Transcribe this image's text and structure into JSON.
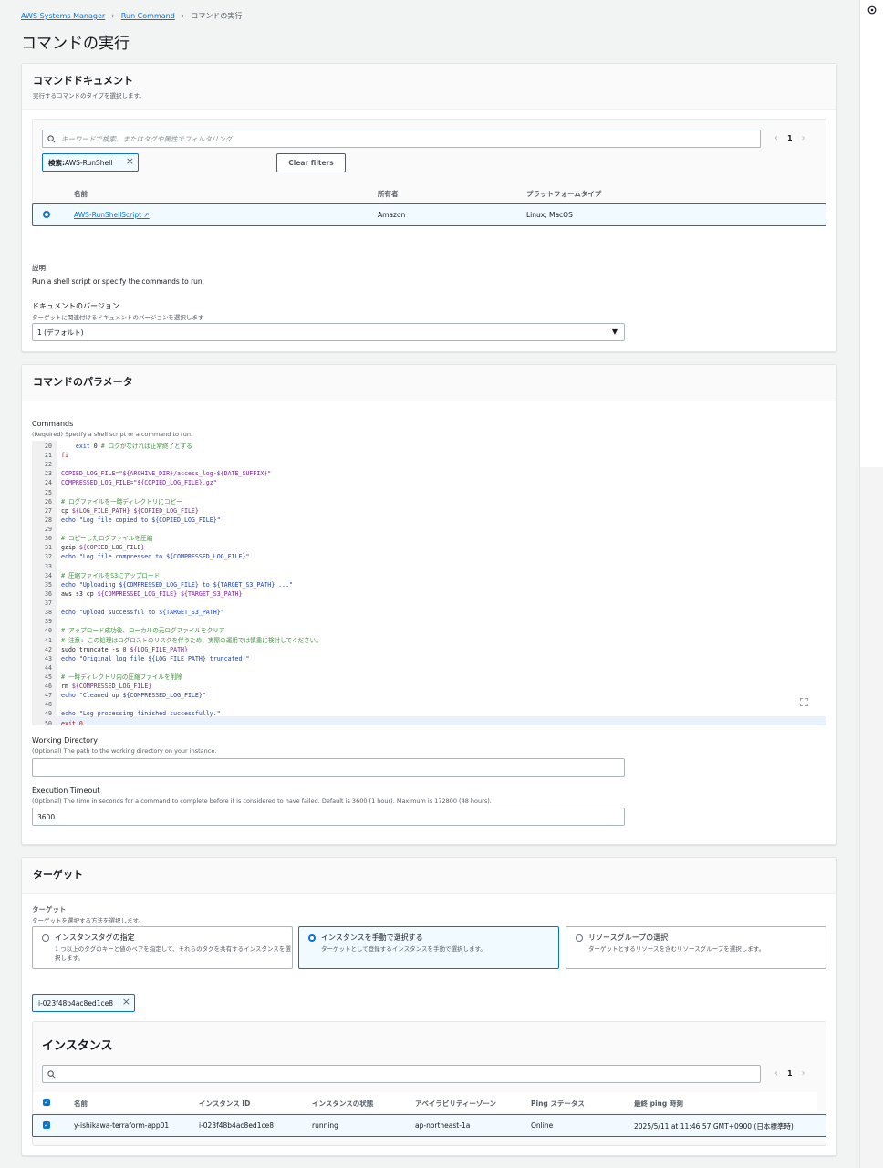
{
  "breadcrumb": {
    "item1": "AWS Systems Manager",
    "item2": "Run Command",
    "current": "コマンドの実行"
  },
  "page_title": "コマンドの実行",
  "doc_panel": {
    "title": "コマンドドキュメント",
    "subtitle": "実行するコマンドのタイプを選択します。",
    "search_placeholder": "キーワードで検索、またはタグや属性でフィルタリング",
    "page_number": "1",
    "filter_token_key": "検索: ",
    "filter_token_value": "AWS-RunShell",
    "clear_filters": "Clear filters",
    "columns": {
      "name": "名前",
      "owner": "所有者",
      "platform": "プラットフォームタイプ"
    },
    "row": {
      "name": "AWS-RunShellScript",
      "owner": "Amazon",
      "platform": "Linux, MacOS"
    },
    "description_label": "説明",
    "description_text": "Run a shell script or specify the commands to run.",
    "version_label": "ドキュメントのバージョン",
    "version_desc": "ターゲットに関連付けるドキュメントのバージョンを選択します",
    "version_value": "1 (デフォルト)"
  },
  "params_panel": {
    "title": "コマンドのパラメータ",
    "commands_label": "Commands",
    "commands_desc": "(Required) Specify a shell script or a command to run.",
    "code_lines": [
      {
        "n": "20",
        "parts": [
          {
            "c": "c-plain",
            "t": "    "
          },
          {
            "c": "c-str",
            "t": "exit"
          },
          {
            "c": "c-plain",
            "t": " 0 "
          },
          {
            "c": "c-cmt",
            "t": "# ログがなければ正常終了とする"
          }
        ]
      },
      {
        "n": "21",
        "parts": [
          {
            "c": "c-kw",
            "t": "fi"
          }
        ]
      },
      {
        "n": "22",
        "parts": []
      },
      {
        "n": "23",
        "parts": [
          {
            "c": "c-var",
            "t": "COPIED_LOG_FILE=\"${ARCHIVE_DIR}/access_log-${DATE_SUFFIX}\""
          }
        ]
      },
      {
        "n": "24",
        "parts": [
          {
            "c": "c-var",
            "t": "COMPRESSED_LOG_FILE=\"${COPIED_LOG_FILE}.gz\""
          }
        ]
      },
      {
        "n": "25",
        "parts": []
      },
      {
        "n": "26",
        "parts": [
          {
            "c": "c-cmt",
            "t": "# ログファイルを一時ディレクトリにコピー"
          }
        ]
      },
      {
        "n": "27",
        "parts": [
          {
            "c": "c-plain",
            "t": "cp "
          },
          {
            "c": "c-var",
            "t": "${LOG_FILE_PATH} ${COPIED_LOG_FILE}"
          }
        ]
      },
      {
        "n": "28",
        "parts": [
          {
            "c": "c-str",
            "t": "echo \"Log file copied to ${COPIED_LOG_FILE}\""
          }
        ]
      },
      {
        "n": "29",
        "parts": []
      },
      {
        "n": "30",
        "parts": [
          {
            "c": "c-cmt",
            "t": "# コピーしたログファイルを圧縮"
          }
        ]
      },
      {
        "n": "31",
        "parts": [
          {
            "c": "c-plain",
            "t": "gzip "
          },
          {
            "c": "c-var",
            "t": "${COPIED_LOG_FILE}"
          }
        ]
      },
      {
        "n": "32",
        "parts": [
          {
            "c": "c-str",
            "t": "echo \"Log file compressed to ${COMPRESSED_LOG_FILE}\""
          }
        ]
      },
      {
        "n": "33",
        "parts": []
      },
      {
        "n": "34",
        "parts": [
          {
            "c": "c-cmt",
            "t": "# 圧縮ファイルをS3にアップロード"
          }
        ]
      },
      {
        "n": "35",
        "parts": [
          {
            "c": "c-str",
            "t": "echo \"Uploading ${COMPRESSED_LOG_FILE} to ${TARGET_S3_PATH} ...\""
          }
        ]
      },
      {
        "n": "36",
        "parts": [
          {
            "c": "c-plain",
            "t": "aws s3 cp "
          },
          {
            "c": "c-var",
            "t": "${COMPRESSED_LOG_FILE} ${TARGET_S3_PATH}"
          }
        ]
      },
      {
        "n": "37",
        "parts": []
      },
      {
        "n": "38",
        "parts": [
          {
            "c": "c-str",
            "t": "echo \"Upload successful to ${TARGET_S3_PATH}\""
          }
        ]
      },
      {
        "n": "39",
        "parts": []
      },
      {
        "n": "40",
        "parts": [
          {
            "c": "c-cmt",
            "t": "# アップロード成功後、ローカルの元ログファイルをクリア"
          }
        ]
      },
      {
        "n": "41",
        "parts": [
          {
            "c": "c-cmt",
            "t": "# 注意: この処理はログロストのリスクを伴うため、実際の運用では慎重に検討してください。"
          }
        ]
      },
      {
        "n": "42",
        "parts": [
          {
            "c": "c-plain",
            "t": "sudo truncate -s "
          },
          {
            "c": "c-kw",
            "t": "0"
          },
          {
            "c": "c-plain",
            "t": " "
          },
          {
            "c": "c-var",
            "t": "${LOG_FILE_PATH}"
          }
        ]
      },
      {
        "n": "43",
        "parts": [
          {
            "c": "c-str",
            "t": "echo \"Original log file ${LOG_FILE_PATH} truncated.\""
          }
        ]
      },
      {
        "n": "44",
        "parts": []
      },
      {
        "n": "45",
        "parts": [
          {
            "c": "c-cmt",
            "t": "# 一時ディレクトリ内の圧縮ファイルを削除"
          }
        ]
      },
      {
        "n": "46",
        "parts": [
          {
            "c": "c-plain",
            "t": "rm "
          },
          {
            "c": "c-var",
            "t": "${COMPRESSED_LOG_FILE}"
          }
        ]
      },
      {
        "n": "47",
        "parts": [
          {
            "c": "c-str",
            "t": "echo \"Cleaned up ${COMPRESSED_LOG_FILE}\""
          }
        ]
      },
      {
        "n": "48",
        "parts": []
      },
      {
        "n": "49",
        "parts": [
          {
            "c": "c-str",
            "t": "echo \"Log processing finished successfully.\""
          }
        ]
      },
      {
        "n": "50",
        "parts": [
          {
            "c": "c-kw",
            "t": "exit 0"
          }
        ]
      }
    ],
    "workdir_label": "Working Directory",
    "workdir_desc": "(Optional) The path to the working directory on your instance.",
    "workdir_value": "",
    "timeout_label": "Execution Timeout",
    "timeout_desc": "(Optional) The time in seconds for a command to complete before it is considered to have failed. Default is 3600 (1 hour). Maximum is 172800 (48 hours).",
    "timeout_value": "3600"
  },
  "target_panel": {
    "title": "ターゲット",
    "label": "ターゲット",
    "desc": "ターゲットを選択する方法を選択します。",
    "options": [
      {
        "title": "インスタンスタグの指定",
        "desc": "1 つ以上のタグのキーと値のペアを指定して、それらのタグを共有するインスタンスを選択します。"
      },
      {
        "title": "インスタンスを手動で選択する",
        "desc": "ターゲットとして登録するインスタンスを手動で選択します。"
      },
      {
        "title": "リソースグループの選択",
        "desc": "ターゲットとするリソースを含むリソースグループを選択します。"
      }
    ],
    "selected_token": "i-023f48b4ac8ed1ce8",
    "instances_title": "インスタンス",
    "instances_search_placeholder": "",
    "page_number": "1",
    "columns": {
      "name": "名前",
      "id": "インスタンス ID",
      "state": "インスタンスの状態",
      "az": "アベイラビリティーゾーン",
      "ping": "Ping ステータス",
      "last_ping": "最終 ping 時刻"
    },
    "row": {
      "name": "y-ishikawa-terraform-app01",
      "id": "i-023f48b4ac8ed1ce8",
      "state": "running",
      "az": "ap-northeast-1a",
      "ping": "Online",
      "last_ping": "2025/5/11 at 11:46:57 GMT+0900 (日本標準時)"
    }
  }
}
